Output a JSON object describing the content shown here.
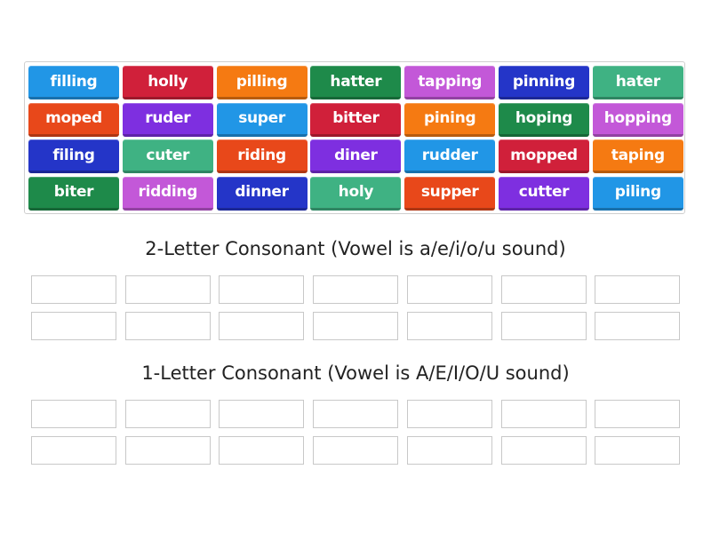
{
  "colors": {
    "light_blue": "#2196e6",
    "red": "#d0203a",
    "orange": "#f57a12",
    "dark_green": "#1e8a4a",
    "pink": "#c358d8",
    "navy": "#2435c8",
    "teal": "#3fb283",
    "red_orange": "#e8481a",
    "purple": "#7e2fe0"
  },
  "tiles": [
    {
      "word": "filling",
      "color": "light_blue"
    },
    {
      "word": "holly",
      "color": "red"
    },
    {
      "word": "pilling",
      "color": "orange"
    },
    {
      "word": "hatter",
      "color": "dark_green"
    },
    {
      "word": "tapping",
      "color": "pink"
    },
    {
      "word": "pinning",
      "color": "navy"
    },
    {
      "word": "hater",
      "color": "teal"
    },
    {
      "word": "moped",
      "color": "red_orange"
    },
    {
      "word": "ruder",
      "color": "purple"
    },
    {
      "word": "super",
      "color": "light_blue"
    },
    {
      "word": "bitter",
      "color": "red"
    },
    {
      "word": "pining",
      "color": "orange"
    },
    {
      "word": "hoping",
      "color": "dark_green"
    },
    {
      "word": "hopping",
      "color": "pink"
    },
    {
      "word": "filing",
      "color": "navy"
    },
    {
      "word": "cuter",
      "color": "teal"
    },
    {
      "word": "riding",
      "color": "red_orange"
    },
    {
      "word": "diner",
      "color": "purple"
    },
    {
      "word": "rudder",
      "color": "light_blue"
    },
    {
      "word": "mopped",
      "color": "red"
    },
    {
      "word": "taping",
      "color": "orange"
    },
    {
      "word": "biter",
      "color": "dark_green"
    },
    {
      "word": "ridding",
      "color": "pink"
    },
    {
      "word": "dinner",
      "color": "navy"
    },
    {
      "word": "holy",
      "color": "teal"
    },
    {
      "word": "supper",
      "color": "red_orange"
    },
    {
      "word": "cutter",
      "color": "purple"
    },
    {
      "word": "piling",
      "color": "light_blue"
    }
  ],
  "groups": [
    {
      "title": "2-Letter Consonant (Vowel is a/e/i/o/u sound)",
      "slots": 14
    },
    {
      "title": "1-Letter Consonant (Vowel is A/E/I/O/U sound)",
      "slots": 14
    }
  ]
}
